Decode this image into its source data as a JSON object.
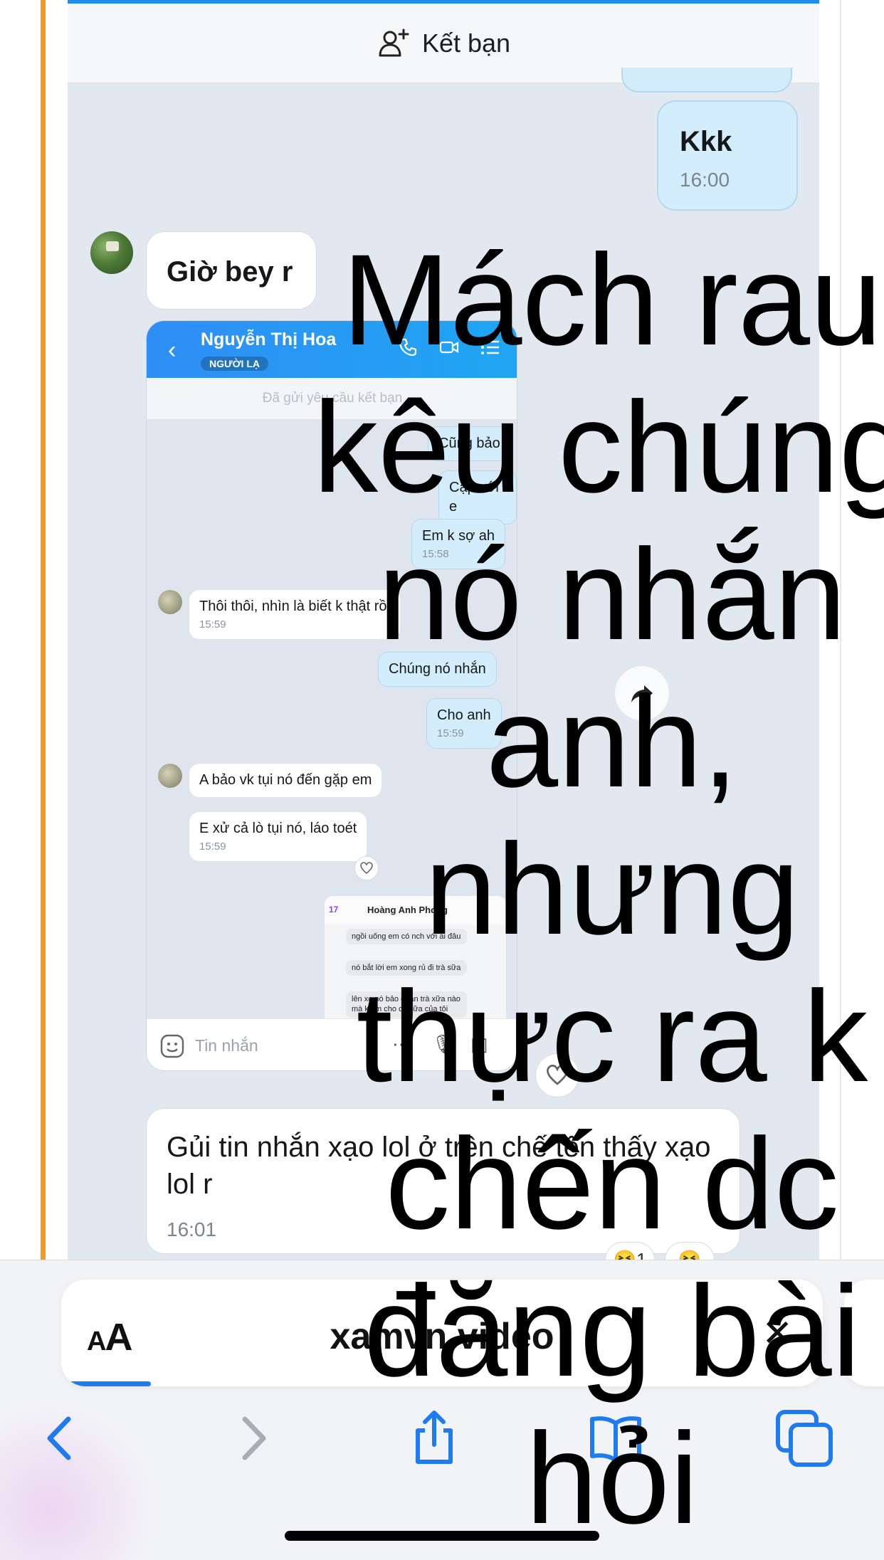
{
  "colors": {
    "accent": "#1f7cf0",
    "orange_rule": "#f39a1f",
    "outgoing_bubble": "#d3edfc",
    "chat_bg": "#e2e8f0"
  },
  "chat": {
    "add_friend_label": "Kết bạn",
    "messages": [
      {
        "text": "Kkk",
        "time": "16:00",
        "direction": "out"
      },
      {
        "text": "Giờ bey r",
        "direction": "in"
      },
      {
        "text": "Gủi tin nhắn xạo lol ở trên chế tên thấy xạo lol r",
        "time": "16:01",
        "direction": "in"
      }
    ],
    "reactions": [
      {
        "icon": "laughing-emoji",
        "count": "1"
      },
      {
        "icon": "laughing-emoji"
      }
    ]
  },
  "screenshot": {
    "contact_name": "Nguyễn Thị Hoa",
    "contact_tag": "NGƯỜI LẠ",
    "request_note": "Đã gửi yêu cầu kết bạn",
    "messages": [
      {
        "text": "Cũng bảo",
        "direction": "out"
      },
      {
        "text": "Cặp với e",
        "direction": "out"
      },
      {
        "text": "Em k sợ ah",
        "time": "15:58",
        "direction": "out"
      },
      {
        "text": "Thôi thôi, nhìn là biết k thật rồi",
        "time": "15:59",
        "direction": "in"
      },
      {
        "text": "Chúng nó nhắn",
        "direction": "out"
      },
      {
        "text": "Cho anh",
        "time": "15:59",
        "direction": "out"
      },
      {
        "text": "A bảo vk tụi nó đến gặp em",
        "direction": "in"
      },
      {
        "text": "E xử cả lò tụi nó, láo toét",
        "time": "15:59",
        "direction": "in"
      }
    ],
    "inner": {
      "badge": "17",
      "name": "Hoàng Anh Phong",
      "messages": [
        "ngồi uống em có nch với ai đâu",
        "nó bắt lời em xong rủ đi trà sữa",
        "lên xe nó bảo quán trà xữa nào mà k em cho có sữa của tôi"
      ]
    },
    "input_placeholder": "Tin nhắn"
  },
  "overlay_caption": [
    "Mách rau",
    "kêu chúng",
    "nó nhắn",
    "anh,",
    "nhưng",
    "thực ra k",
    "chến dc",
    "đăng bài",
    "hỏi"
  ],
  "browser": {
    "aa_label": "A",
    "aa_label_big": "A",
    "url": "xamvn.video",
    "close_icon": "close-icon",
    "toolbar": [
      "back-icon",
      "forward-icon",
      "share-icon",
      "bookmarks-icon",
      "tabs-icon"
    ]
  }
}
